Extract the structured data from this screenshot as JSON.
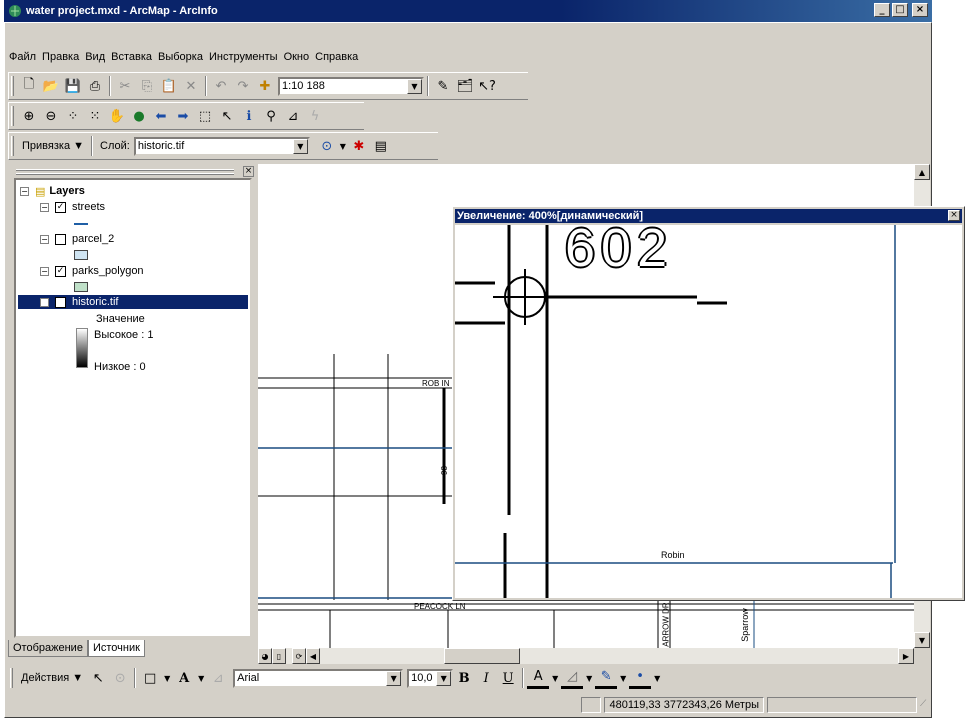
{
  "window": {
    "title": "water project.mxd - ArcMap - ArcInfo",
    "minimize": "_",
    "maximize": "□",
    "close": "×"
  },
  "menu": [
    "Файл",
    "Правка",
    "Вид",
    "Вставка",
    "Выборка",
    "Инструменты",
    "Окно",
    "Справка"
  ],
  "standard_toolbar": {
    "scale": "1:10 188"
  },
  "editor_toolbar": {
    "snap_label": "Привязка ▼",
    "layer_label": "Слой:",
    "layer_value": "historic.tif"
  },
  "toc": {
    "root": "Layers",
    "layers": [
      {
        "name": "streets",
        "checked": true
      },
      {
        "name": "parcel_2",
        "checked": false
      },
      {
        "name": "parks_polygon",
        "checked": true
      },
      {
        "name": "historic.tif",
        "checked": true
      }
    ],
    "raster_legend": {
      "heading": "Значение",
      "high": "Высокое : 1",
      "low": "Низкое : 0"
    },
    "tabs": [
      "Отображение",
      "Источник"
    ]
  },
  "map_labels": {
    "robin_ln": "ROB IN",
    "peacock_ln": "PEACOCK LN",
    "number_98": "98",
    "arrow_dr": "ARROW DR",
    "sparrow": "Sparrow"
  },
  "magnifier": {
    "title": "Увеличение: 400%[динамический]",
    "parcel_number": "602",
    "street_label": "Robin"
  },
  "draw_toolbar": {
    "actions_label": "Действия ▼",
    "font": "Arial",
    "size": "10,0",
    "bold": "B",
    "italic": "I",
    "underline": "U"
  },
  "status": {
    "coords": "480119,33  3772343,26 Метры"
  }
}
